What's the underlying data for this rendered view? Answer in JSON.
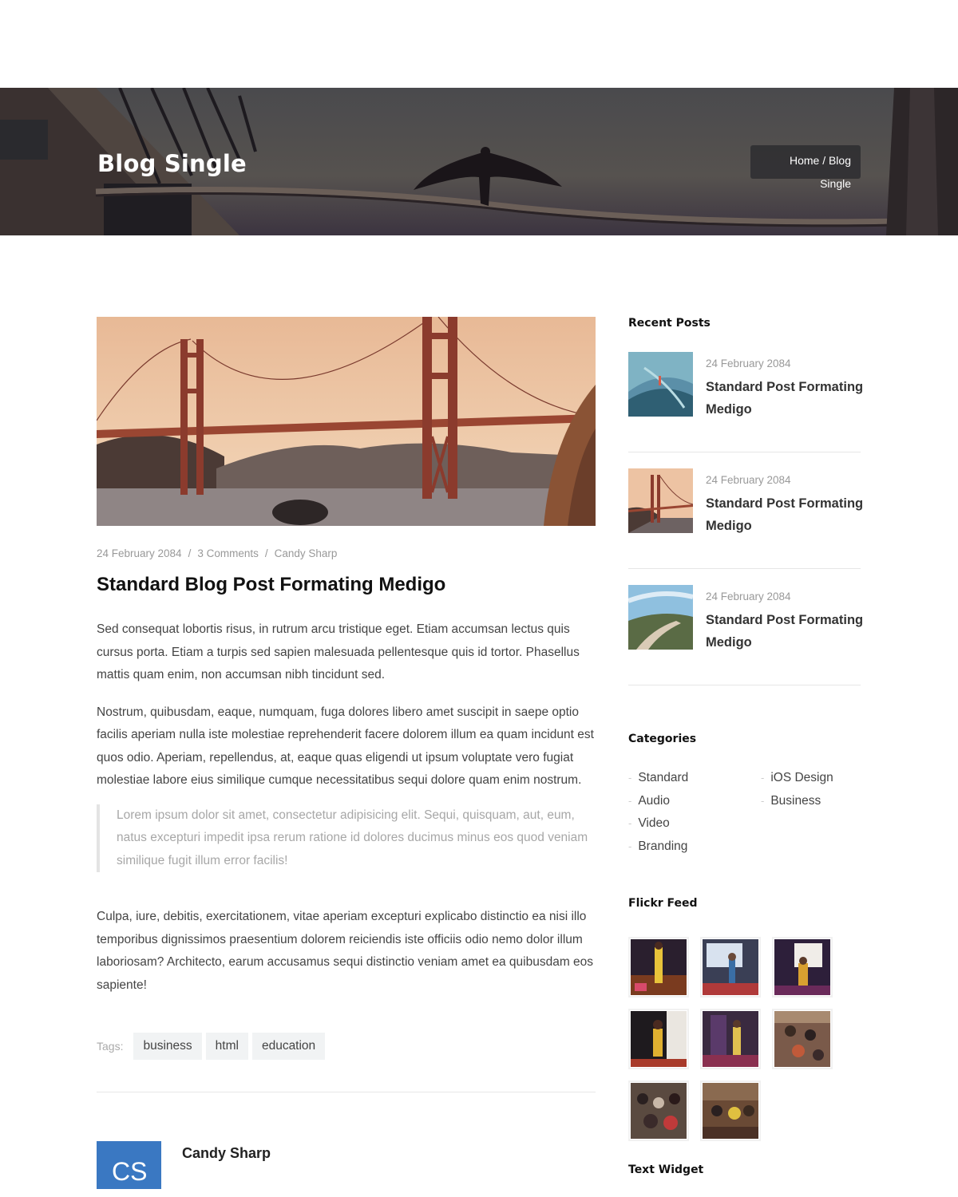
{
  "hero": {
    "title": "Blog Single",
    "breadcrumb_line1": "Home / Blog",
    "breadcrumb_line2": "Single"
  },
  "post": {
    "date": "24 February 2084",
    "comments": "3 Comments",
    "author": "Candy Sharp",
    "separator": "/",
    "title": "Standard Blog Post Formating Medigo",
    "paragraphs": [
      "Sed consequat lobortis risus, in rutrum arcu tristique eget. Etiam accumsan lectus quis cursus porta. Etiam a turpis sed sapien malesuada pellentesque quis id tortor. Phasellus mattis quam enim, non accumsan nibh tincidunt sed.",
      "Nostrum, quibusdam, eaque, numquam, fuga dolores libero amet suscipit in saepe optio facilis aperiam nulla iste molestiae reprehenderit facere dolorem illum ea quam incidunt est quos odio. Aperiam, repellendus, at, eaque quas eligendi ut ipsum voluptate vero fugiat molestiae labore eius similique cumque necessitatibus sequi dolore quam enim nostrum.",
      "Culpa, iure, debitis, exercitationem, vitae aperiam excepturi explicabo distinctio ea nisi illo temporibus dignissimos praesentium dolorem reiciendis iste officiis odio nemo dolor illum laboriosam? Architecto, earum accusamus sequi distinctio veniam amet ea quibusdam eos sapiente!"
    ],
    "quote": "Lorem ipsum dolor sit amet, consectetur adipisicing elit. Sequi, quisquam, aut, eum, natus excepturi impedit ipsa rerum ratione id dolores ducimus minus eos quod veniam similique fugit illum error facilis!",
    "tags_label": "Tags:",
    "tags": [
      "business",
      "html",
      "education"
    ]
  },
  "author_box": {
    "initials": "CS",
    "name": "Candy Sharp",
    "avatar_color": "#3a78c2"
  },
  "sidebar": {
    "recent_title": "Recent Posts",
    "recent_posts": [
      {
        "date": "24 February 2084",
        "title": "Standard Post Formating Medigo"
      },
      {
        "date": "24 February 2084",
        "title": "Standard Post Formating Medigo"
      },
      {
        "date": "24 February 2084",
        "title": "Standard Post Formating Medigo"
      }
    ],
    "categories_title": "Categories",
    "categories_col1": [
      "Standard",
      "Audio",
      "Video",
      "Branding"
    ],
    "categories_col2": [
      "iOS Design",
      "Business"
    ],
    "category_bullet": "-",
    "flickr_title": "Flickr Feed",
    "flickr_count": 8,
    "text_widget_title": "Text Widget"
  }
}
